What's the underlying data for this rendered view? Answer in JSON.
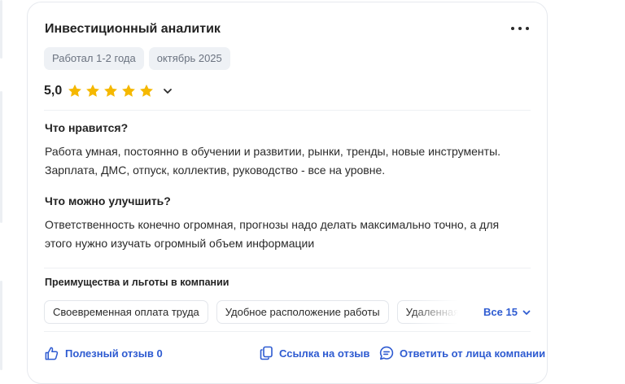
{
  "review": {
    "title": "Инвестиционный аналитик",
    "tags": [
      "Работал 1-2 года",
      "октябрь 2025"
    ],
    "rating": {
      "score_label": "5,0",
      "value": 5,
      "max": 5
    },
    "likes": {
      "title": "Что нравится?",
      "lines": [
        "Работа умная, постоянно в обучении и развитии, рынки, тренды, новые инструменты.",
        "Зарплата, ДМС, отпуск, коллектив, руководство - все на уровне."
      ]
    },
    "improve": {
      "title": "Что можно улучшить?",
      "lines": [
        "Ответственность конечно огромная, прогнозы надо делать максимально точно, а для",
        "этого нужно изучать огромный объем информации"
      ]
    },
    "benefits": {
      "title": "Преимущества и льготы в компании",
      "chips": [
        "Своевременная оплата труда",
        "Удобное расположение работы",
        "Удаленная работа"
      ],
      "see_all": "Все 15"
    },
    "actions": {
      "helpful": "Полезный отзыв 0",
      "link": "Ссылка на отзыв",
      "reply": "Ответить от лица компании"
    }
  },
  "colors": {
    "accent": "#2e5bd1",
    "star": "#f5b800",
    "tag_bg": "#eef1f5",
    "border": "#e6e9ee"
  },
  "icons": {
    "menu": "more-dots-icon",
    "star": "star-icon",
    "expand": "chevron-down-icon",
    "helpful": "thumb-up-icon",
    "link": "copy-link-icon",
    "reply": "chat-bubble-icon"
  }
}
